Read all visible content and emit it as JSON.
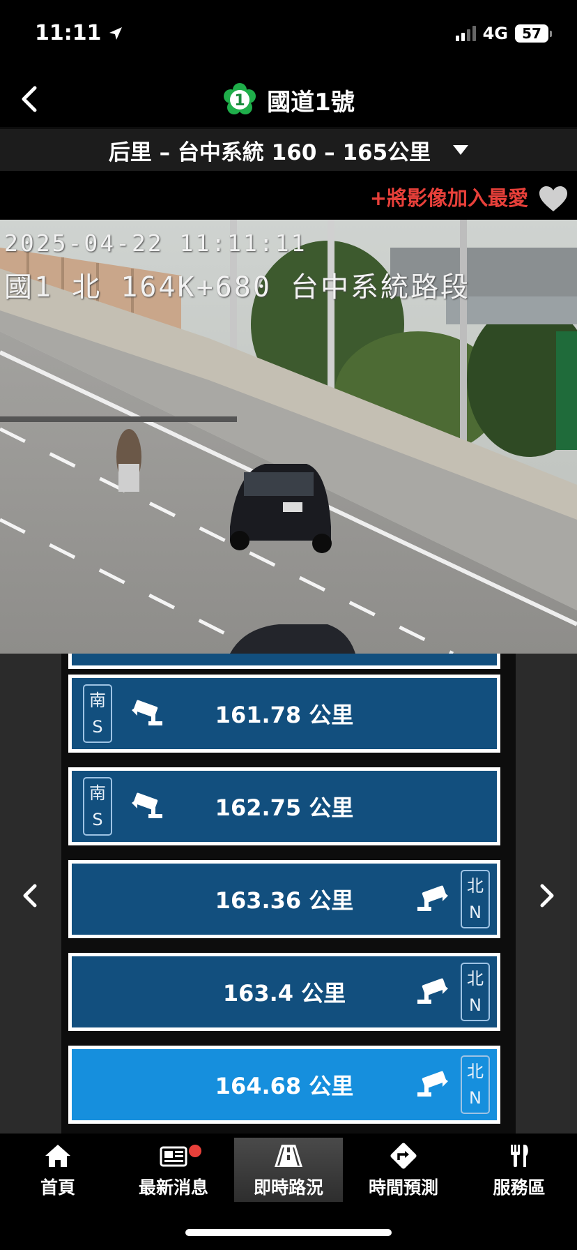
{
  "status": {
    "time": "11:11",
    "network": "4G",
    "battery": "57"
  },
  "header": {
    "title": "國道1號",
    "badge": "1"
  },
  "section": {
    "label": "后里 – 台中系統 160 – 165公里"
  },
  "favorite": {
    "label": "+將影像加入最愛"
  },
  "camera": {
    "timestamp": "2025-04-22 11:11:11",
    "location": "國1 北 164K+680 台中系統路段"
  },
  "cameras": [
    {
      "km": "161.78 公里",
      "dir_cn": "南",
      "dir_en": "S",
      "side": "left",
      "active": false
    },
    {
      "km": "162.75 公里",
      "dir_cn": "南",
      "dir_en": "S",
      "side": "left",
      "active": false
    },
    {
      "km": "163.36 公里",
      "dir_cn": "北",
      "dir_en": "N",
      "side": "right",
      "active": false
    },
    {
      "km": "163.4 公里",
      "dir_cn": "北",
      "dir_en": "N",
      "side": "right",
      "active": false
    },
    {
      "km": "164.68 公里",
      "dir_cn": "北",
      "dir_en": "N",
      "side": "right",
      "active": true
    }
  ],
  "tabs": [
    {
      "label": "首頁",
      "icon": "home-icon"
    },
    {
      "label": "最新消息",
      "icon": "news-icon"
    },
    {
      "label": "即時路況",
      "icon": "road-icon"
    },
    {
      "label": "時間預測",
      "icon": "route-icon"
    },
    {
      "label": "服務區",
      "icon": "utensils-icon"
    }
  ],
  "colors": {
    "item_bg": "#124f7e",
    "item_active_bg": "#168fdd",
    "favorite_text": "#e8403a"
  }
}
